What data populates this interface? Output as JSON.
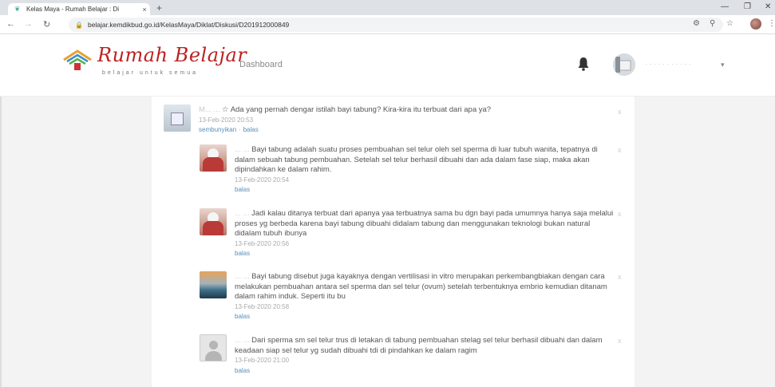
{
  "browser": {
    "tab_title": "Kelas Maya - Rumah Belajar : Di",
    "tab_close": "×",
    "new_tab": "+",
    "url": "belajar.kemdikbud.go.id/KelasMaya/Diklat/Diskusi/D201912000849"
  },
  "header": {
    "logo_text": "Rumah Belajar",
    "logo_sub": "belajar untuk semua",
    "nav_dashboard": "Dashboard"
  },
  "posts": [
    {
      "author": "M... ...",
      "star": "☆",
      "text": "Ada yang pernah dengar istilah bayi tabung? Kira-kira itu terbuat dari apa ya?",
      "timestamp": "13-Feb-2020 20:53",
      "hide_link": "sembunyikan",
      "separator": "·",
      "reply_link": "balas",
      "delete": "x"
    },
    {
      "author": "... ...",
      "text": "Bayi tabung adalah suatu proses pembuahan sel telur oleh sel sperma di luar tubuh wanita, tepatnya di dalam sebuah tabung pembuahan. Setelah sel telur berhasil dibuahi dan ada dalam fase siap, maka akan dipindahkan ke dalam rahim.",
      "timestamp": "13-Feb-2020 20:54",
      "reply_link": "balas",
      "delete": "x"
    },
    {
      "author": "... ...",
      "text": "Jadi kalau ditanya terbuat dari apanya yaa terbuatnya sama bu dgn bayi pada umumnya hanya saja melalui proses yg berbeda karena bayi tabung dibuahi didalam tabung dan menggunakan teknologi bukan natural didalam tubuh ibunya",
      "timestamp": "13-Feb-2020 20:56",
      "reply_link": "balas",
      "delete": "x"
    },
    {
      "author": "... ...",
      "text": "Bayi tabung disebut juga kayaknya dengan vertilisasi in vitro merupakan perkembangbiakan dengan cara melakukan pembuahan antara sel sperma dan sel telur (ovum) setelah terbentuknya embrio kemudian ditanam dalam rahim induk. Seperti itu bu",
      "timestamp": "13-Feb-2020 20:58",
      "reply_link": "balas",
      "delete": "x"
    },
    {
      "author": "... ...",
      "text": "Dari sperma sm sel telur trus di letakan di tabung pembuahan stelag sel telur berhasil dibuahi dan dalam keadaan siap sel telur yg sudah dibuahi tdi di pindahkan ke dalam ragim",
      "timestamp": "13-Feb-2020 21:00",
      "reply_link": "balas",
      "delete": "x"
    }
  ]
}
